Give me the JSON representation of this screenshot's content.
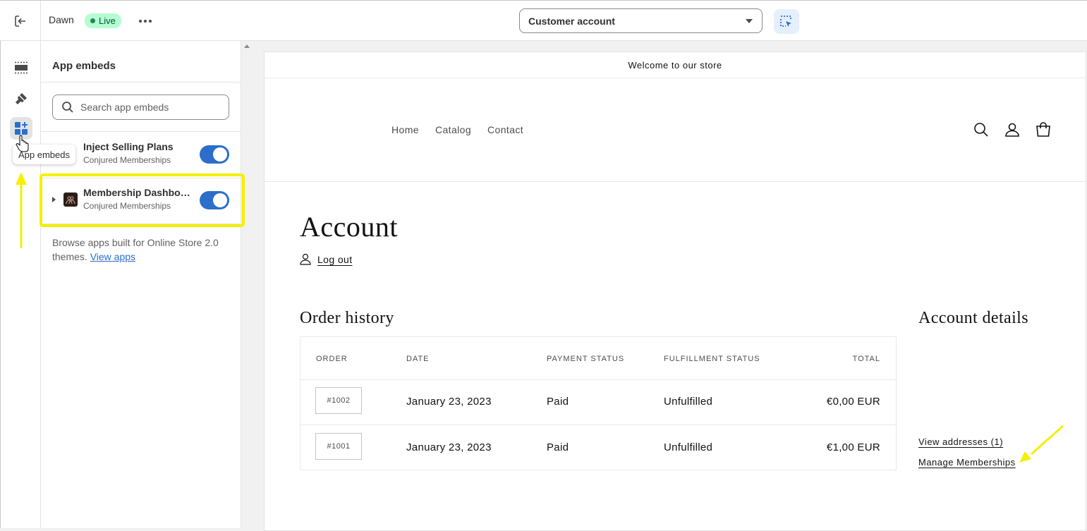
{
  "topbar": {
    "theme_name": "Dawn",
    "status_badge": "Live",
    "page_selector": "Customer account"
  },
  "rail": {
    "tooltip": "App embeds"
  },
  "panel": {
    "title": "App embeds",
    "search_placeholder": "Search app embeds",
    "embeds": [
      {
        "name": "Inject Selling Plans",
        "vendor": "Conjured Memberships",
        "enabled": true
      },
      {
        "name": "Membership Dashboard",
        "vendor": "Conjured Memberships",
        "enabled": true
      }
    ],
    "browse_text": "Browse apps built for Online Store 2.0 themes.",
    "browse_link": "View apps"
  },
  "preview": {
    "announcement": "Welcome to our store",
    "nav": [
      "Home",
      "Catalog",
      "Contact"
    ],
    "account_title": "Account",
    "logout": "Log out",
    "order_history_title": "Order history",
    "account_details_title": "Account details",
    "order_columns": [
      "ORDER",
      "DATE",
      "PAYMENT STATUS",
      "FULFILLMENT STATUS",
      "TOTAL"
    ],
    "orders": [
      {
        "order": "#1002",
        "date": "January 23, 2023",
        "payment": "Paid",
        "fulfillment": "Unfulfilled",
        "total": "€0,00 EUR"
      },
      {
        "order": "#1001",
        "date": "January 23, 2023",
        "payment": "Paid",
        "fulfillment": "Unfulfilled",
        "total": "€1,00 EUR"
      }
    ],
    "view_addresses": "View addresses (1)",
    "manage_memberships": "Manage Memberships"
  },
  "colors": {
    "accent": "#2c6ecb",
    "live_badge": "#b4fed2",
    "annotation": "#f4f000"
  }
}
